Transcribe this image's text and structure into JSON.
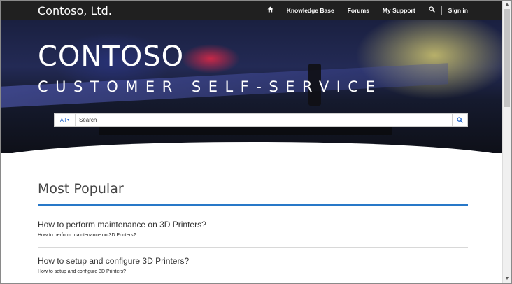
{
  "navbar": {
    "brand": "Contoso, Ltd.",
    "items": [
      {
        "label": "",
        "icon": "home-icon"
      },
      {
        "label": "Knowledge Base"
      },
      {
        "label": "Forums"
      },
      {
        "label": "My Support"
      },
      {
        "label": "",
        "icon": "search-icon"
      },
      {
        "label": "Sign in"
      }
    ]
  },
  "hero": {
    "title": "CONTOSO",
    "subtitle": "CUSTOMER SELF-SERVICE"
  },
  "search": {
    "scope": "All",
    "placeholder": "Search"
  },
  "main": {
    "section_title": "Most Popular",
    "articles": [
      {
        "title": "How to perform maintenance on 3D Printers?",
        "description": "How to perform maintenance on 3D Printers?"
      },
      {
        "title": "How to setup and configure 3D Printers?",
        "description": "How to setup and configure 3D Printers?"
      }
    ]
  },
  "colors": {
    "navbar_bg": "#202020",
    "accent": "#2878c8",
    "link_blue": "#2266cc"
  }
}
